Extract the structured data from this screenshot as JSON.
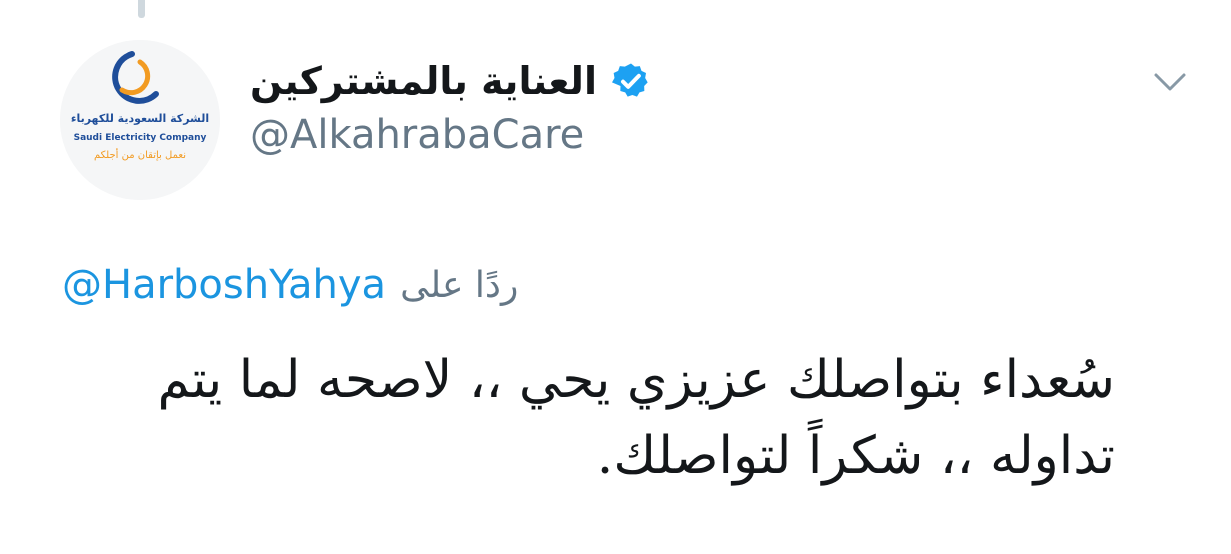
{
  "tweet": {
    "author": {
      "display_name": "العناية بالمشتركين",
      "handle": "@AlkahrabaCare",
      "verified": true,
      "avatar": {
        "icon": "saudi-electricity-logo",
        "text_ar": "الشركة السعودية للكهرباء",
        "text_en": "Saudi Electricity Company",
        "slogan_ar": "نعمل بإتقان من أجلكم",
        "brand_blue": "#1f4e9a",
        "brand_orange": "#f29b22"
      }
    },
    "reply_to": {
      "prefix": "ردًا على",
      "handle": "@HarboshYahya"
    },
    "text": "سُعداء بتواصلك عزيزي يحي ،، لاصحه لما يتم تداوله ،، شكراً لتواصلك."
  },
  "icons": {
    "verified": "verified-badge-icon",
    "menu": "chevron-down-icon"
  },
  "colors": {
    "link_blue": "#1b95e0",
    "verified_blue": "#1da1f2",
    "secondary_text": "#657786",
    "primary_text": "#14171a",
    "thread_line": "#cfd8de"
  }
}
